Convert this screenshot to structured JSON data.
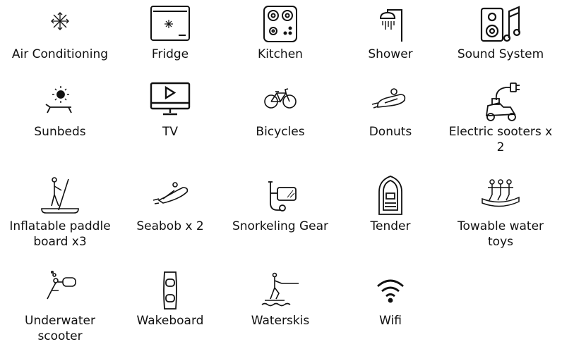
{
  "amenities": [
    {
      "label": "Air Conditioning",
      "icon": "snowflake-icon"
    },
    {
      "label": "Fridge",
      "icon": "fridge-icon"
    },
    {
      "label": "Kitchen",
      "icon": "cooktop-icon"
    },
    {
      "label": "Shower",
      "icon": "shower-icon"
    },
    {
      "label": "Sound System",
      "icon": "speaker-music-icon"
    },
    {
      "label": "Sunbeds",
      "icon": "sunbed-icon"
    },
    {
      "label": "TV",
      "icon": "tv-icon"
    },
    {
      "label": "Bicycles",
      "icon": "bicycle-icon"
    },
    {
      "label": "Donuts",
      "icon": "donut-tube-icon"
    },
    {
      "label": "Electric sooters x 2",
      "icon": "electric-scooter-icon"
    },
    {
      "label": "Inflatable paddle board x3",
      "icon": "paddle-board-icon"
    },
    {
      "label": "Seabob x 2",
      "icon": "seabob-icon"
    },
    {
      "label": "Snorkeling Gear",
      "icon": "snorkel-mask-icon"
    },
    {
      "label": "Tender",
      "icon": "tender-boat-icon"
    },
    {
      "label": "Towable water toys",
      "icon": "towable-toys-icon"
    },
    {
      "label": "Underwater scooter",
      "icon": "underwater-scooter-icon"
    },
    {
      "label": "Wakeboard",
      "icon": "wakeboard-icon"
    },
    {
      "label": "Waterskis",
      "icon": "waterski-icon"
    },
    {
      "label": "Wifi",
      "icon": "wifi-icon"
    }
  ]
}
